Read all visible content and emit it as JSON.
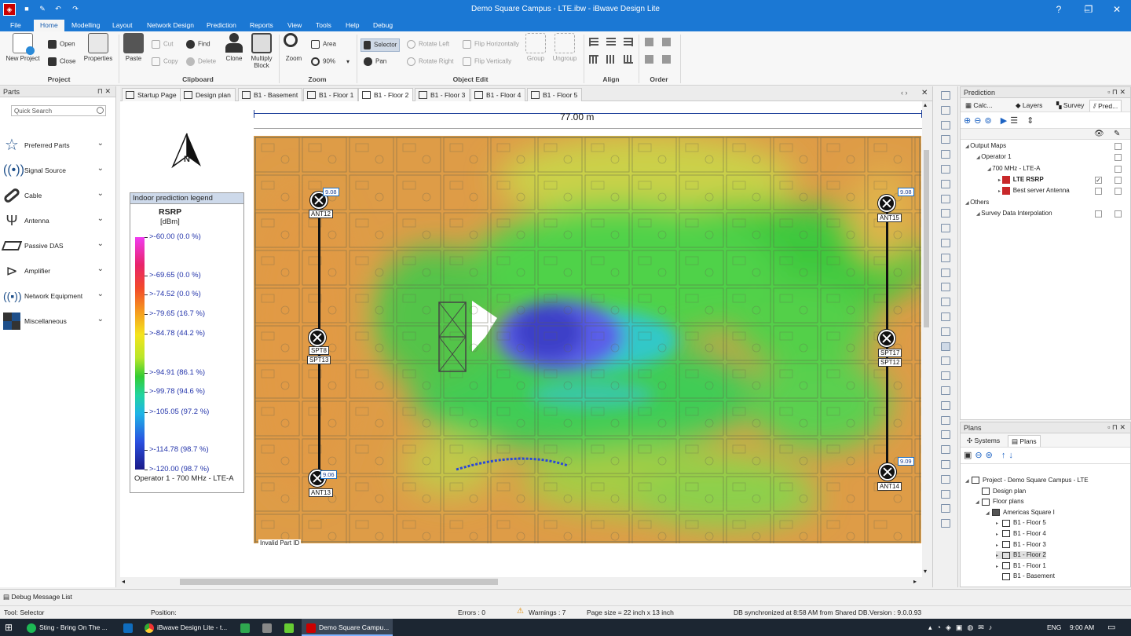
{
  "app": {
    "title": "Demo Square Campus - LTE.ibw - iBwave Design Lite",
    "window_controls": [
      "?",
      "–",
      "❐",
      "✕"
    ]
  },
  "menu": [
    {
      "label": "File",
      "active": false
    },
    {
      "label": "Home",
      "active": true
    },
    {
      "label": "Modelling",
      "active": false
    },
    {
      "label": "Layout",
      "active": false
    },
    {
      "label": "Network Design",
      "active": false
    },
    {
      "label": "Prediction",
      "active": false
    },
    {
      "label": "Reports",
      "active": false
    },
    {
      "label": "View",
      "active": false
    },
    {
      "label": "Tools",
      "active": false
    },
    {
      "label": "Help",
      "active": false
    },
    {
      "label": "Debug",
      "active": false
    }
  ],
  "ribbon": {
    "groups": [
      "Project",
      "Clipboard",
      "Zoom",
      "Object Edit",
      "Align",
      "Order"
    ],
    "project": {
      "new_project": "New Project",
      "open": "Open",
      "close": "Close",
      "properties": "Properties"
    },
    "clipboard": {
      "paste": "Paste",
      "cut": "Cut",
      "copy": "Copy",
      "find": "Find",
      "delete": "Delete",
      "clone": "Clone",
      "multiply_block": "Multiply Block"
    },
    "zoom": {
      "zoom": "Zoom",
      "area": "Area",
      "percent": "90%"
    },
    "object_edit": {
      "selector": "Selector",
      "pan": "Pan",
      "rotate_left": "Rotate Left",
      "rotate_right": "Rotate Right",
      "flip_h": "Flip Horizontally",
      "flip_v": "Flip Vertically",
      "group": "Group",
      "ungroup": "Ungroup"
    }
  },
  "parts": {
    "title": "Parts",
    "search_placeholder": "Quick Search",
    "items": [
      {
        "label": "Preferred Parts",
        "icon": "star-icon"
      },
      {
        "label": "Signal Source",
        "icon": "signal-source-icon"
      },
      {
        "label": "Cable",
        "icon": "cable-icon"
      },
      {
        "label": "Antenna",
        "icon": "antenna-icon"
      },
      {
        "label": "Passive DAS",
        "icon": "passive-das-icon"
      },
      {
        "label": "Amplifier",
        "icon": "amplifier-icon"
      },
      {
        "label": "Network Equipment",
        "icon": "network-equipment-icon"
      },
      {
        "label": "Miscellaneous",
        "icon": "miscellaneous-icon"
      }
    ]
  },
  "doc_tabs": [
    {
      "label": "Startup Page",
      "active": false
    },
    {
      "label": "Design plan",
      "active": false
    },
    {
      "label": "B1 - Basement",
      "active": false
    },
    {
      "label": "B1 - Floor 1",
      "active": false
    },
    {
      "label": "B1 - Floor 2",
      "active": true
    },
    {
      "label": "B1 - Floor 3",
      "active": false
    },
    {
      "label": "B1 - Floor 4",
      "active": false
    },
    {
      "label": "B1 - Floor 5",
      "active": false
    }
  ],
  "plan": {
    "scale_label": "77.00 m",
    "compass_label": "N",
    "invalid_label": "Invalid Part ID",
    "antennas": [
      {
        "label": "ANT12",
        "badge": "9.08"
      },
      {
        "label": "ANT15",
        "badge": "9.08"
      },
      {
        "label": "SPT8",
        "label2": "SPT13"
      },
      {
        "label": "SPT17",
        "label2": "SPT12"
      },
      {
        "label": "ANT13",
        "badge": "9.06"
      },
      {
        "label": "ANT14",
        "badge": "9.09"
      }
    ]
  },
  "legend": {
    "title": "Indoor prediction legend",
    "metric": "RSRP",
    "unit": "[dBm]",
    "rows": [
      {
        "label": ">-60.00 (0.0 %)",
        "level": 0.0
      },
      {
        "label": ">-69.65 (0.0 %)",
        "level": 0.165
      },
      {
        "label": ">-74.52 (0.0 %)",
        "level": 0.246
      },
      {
        "label": ">-79.65 (16.7 %)",
        "level": 0.331
      },
      {
        "label": ">-84.78 (44.2 %)",
        "level": 0.416
      },
      {
        "label": ">-94.91 (86.1 %)",
        "level": 0.584
      },
      {
        "label": ">-99.78 (94.6 %)",
        "level": 0.666
      },
      {
        "label": ">-105.05 (97.2 %)",
        "level": 0.752
      },
      {
        "label": ">-114.78 (98.7 %)",
        "level": 0.915
      },
      {
        "label": ">-120.00 (98.7 %)",
        "level": 1.0
      }
    ],
    "footer": "Operator 1 - 700 MHz - LTE-A"
  },
  "prediction_panel": {
    "title": "Prediction",
    "tabs": [
      {
        "label": "Calc...",
        "active": false
      },
      {
        "label": "Layers",
        "active": false
      },
      {
        "label": "Survey",
        "active": false
      },
      {
        "label": "Pred...",
        "active": true
      }
    ],
    "tree": [
      {
        "label": "Output Maps",
        "depth": 0,
        "checked": false,
        "bold": false
      },
      {
        "label": "Operator 1",
        "depth": 1,
        "checked": false,
        "bold": false
      },
      {
        "label": "700 MHz - LTE-A",
        "depth": 2,
        "checked": false,
        "bold": false
      },
      {
        "label": "LTE RSRP",
        "depth": 3,
        "checked": true,
        "bold": true
      },
      {
        "label": "Best server Antenna",
        "depth": 3,
        "checked": false,
        "bold": false
      },
      {
        "label": "Others",
        "depth": 0,
        "checked": null,
        "bold": false
      },
      {
        "label": "Survey Data Interpolation",
        "depth": 1,
        "checked": false,
        "bold": false
      }
    ]
  },
  "plans_panel": {
    "title": "Plans",
    "tabs": [
      {
        "label": "Systems",
        "active": false
      },
      {
        "label": "Plans",
        "active": true
      }
    ],
    "tree": [
      {
        "label": "Project - Demo Square Campus - LTE",
        "depth": 0,
        "selected": false
      },
      {
        "label": "Design plan",
        "depth": 1,
        "selected": false
      },
      {
        "label": "Floor plans",
        "depth": 1,
        "selected": false
      },
      {
        "label": "Americas Square I",
        "depth": 2,
        "selected": false
      },
      {
        "label": "B1 - Floor 5",
        "depth": 3,
        "selected": false
      },
      {
        "label": "B1 - Floor 4",
        "depth": 3,
        "selected": false
      },
      {
        "label": "B1 - Floor 3",
        "depth": 3,
        "selected": false
      },
      {
        "label": "B1 - Floor 2",
        "depth": 3,
        "selected": true
      },
      {
        "label": "B1 - Floor 1",
        "depth": 3,
        "selected": false
      },
      {
        "label": "B1 - Basement",
        "depth": 3,
        "selected": false
      }
    ]
  },
  "status": {
    "debug_list": "Debug Message List",
    "tool": "Tool: Selector",
    "position": "Position:",
    "errors": "Errors : 0",
    "warnings": "Warnings : 7",
    "page_size": "Page size = 22 inch x 13 inch",
    "db_sync": "DB synchronized at 8:58 AM from Shared DB.",
    "version": "Version : 9.0.0.93"
  },
  "taskbar": {
    "items": [
      "Sting - Bring On The ...",
      "iBwave Design Lite - t...",
      "Demo Square Campu..."
    ],
    "lang": "ENG",
    "time": "9:00 AM"
  }
}
